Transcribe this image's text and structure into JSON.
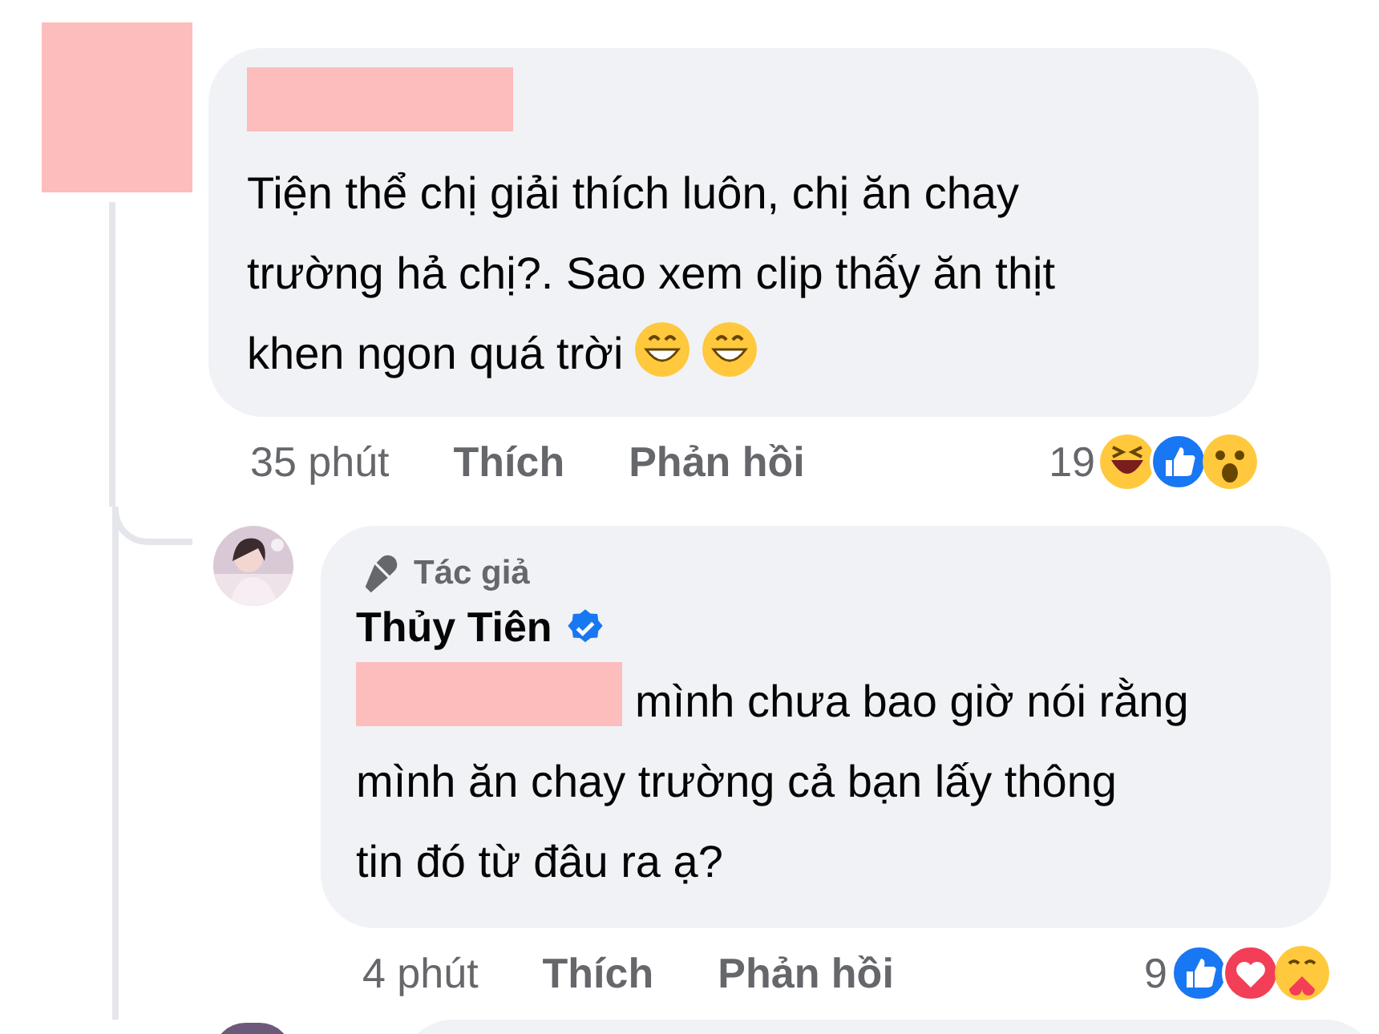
{
  "comments": [
    {
      "avatar": {
        "kind": "redacted"
      },
      "text_lines": [
        "Tiện thể chị giải thích luôn, chị ăn chay",
        "trường hả chị?. Sao xem clip thấy ăn thịt",
        "khen ngon quá trời"
      ],
      "trailing_emoji": [
        {
          "kind": "grin"
        },
        {
          "kind": "grin"
        }
      ],
      "mention_redacted": false,
      "time": "35 phút",
      "like": "Thích",
      "reply": "Phản hồi",
      "reaction_count": "19",
      "reactions": [
        {
          "kind": "haha"
        },
        {
          "kind": "like"
        },
        {
          "kind": "wow"
        }
      ]
    },
    {
      "author": {
        "badge": "Tác giả",
        "name": "Thủy Tiên",
        "verified": true
      },
      "text_lines": [
        "mình chưa bao giờ nói rằng",
        "mình ăn chay trường cả bạn lấy thông",
        "tin đó từ đâu ra ạ?"
      ],
      "mention_redacted": true,
      "time": "4 phút",
      "like": "Thích",
      "reply": "Phản hồi",
      "reaction_count": "9",
      "reactions": [
        {
          "kind": "like"
        },
        {
          "kind": "love"
        },
        {
          "kind": "care"
        }
      ]
    }
  ]
}
